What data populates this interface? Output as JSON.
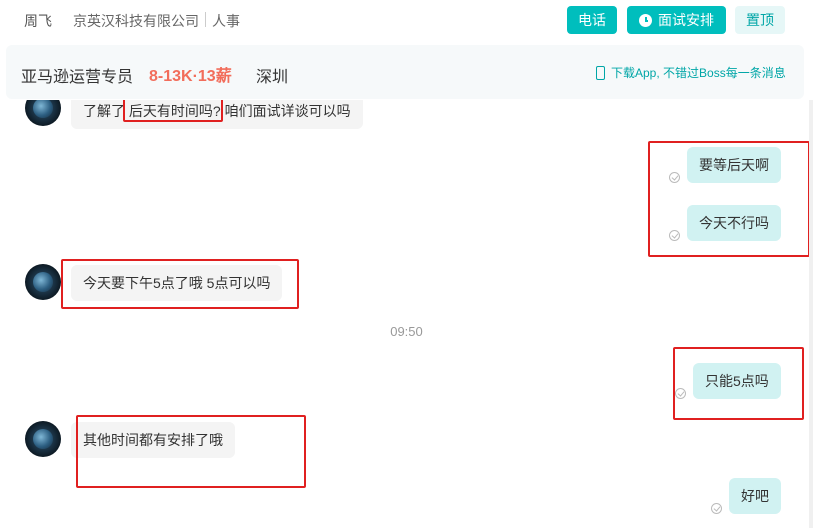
{
  "header": {
    "contact_name": "周飞",
    "company": "京英汉科技有限公司",
    "role": "人事",
    "call_label": "电话",
    "interview_label": "面试安排",
    "pin_label": "置顶"
  },
  "job": {
    "title": "亚马逊运营专员",
    "salary": "8-13K·13薪",
    "city": "深圳",
    "promo": "下载App, 不错过Boss每一条消息"
  },
  "messages": [
    {
      "from": "them",
      "text": "了解了 后天有时间吗? 咱们面试详谈可以吗"
    },
    {
      "from": "me",
      "text": "要等后天啊"
    },
    {
      "from": "me",
      "text": "今天不行吗"
    },
    {
      "from": "them",
      "text": "今天要下午5点了哦 5点可以吗"
    },
    {
      "from": "me",
      "text": "只能5点吗"
    },
    {
      "from": "them",
      "text": "其他时间都有安排了哦"
    },
    {
      "from": "me",
      "text": "好吧"
    }
  ],
  "timestamp": "09:50",
  "colors": {
    "accent": "#00bebd",
    "salary": "#f26d5b",
    "annotation": "#e02020"
  }
}
